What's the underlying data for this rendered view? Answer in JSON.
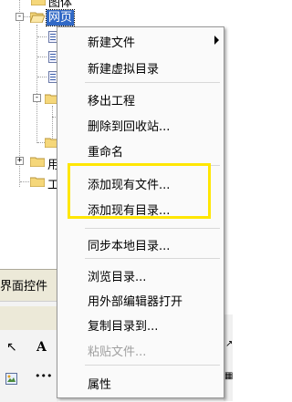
{
  "tree": {
    "nodes": [
      {
        "label": "图体"
      },
      {
        "label": "网页"
      },
      {
        "label": "用"
      },
      {
        "label": "工"
      }
    ]
  },
  "panel": {
    "tab_label": "界面控件",
    "tool_icons": [
      "pointer-icon",
      "text-a-icon",
      "image-icon",
      "dots-icon"
    ]
  },
  "context_menu": {
    "items": [
      {
        "label": "新建文件",
        "submenu": true
      },
      {
        "label": "新建虚拟目录"
      },
      {
        "label": "移出工程"
      },
      {
        "label": "删除到回收站..."
      },
      {
        "label": "重命名"
      },
      {
        "label": "添加现有文件..."
      },
      {
        "label": "添加现有目录..."
      },
      {
        "label": "同步本地目录..."
      },
      {
        "label": "浏览目录..."
      },
      {
        "label": "用外部编辑器打开"
      },
      {
        "label": "复制目录到..."
      },
      {
        "label": "粘贴文件...",
        "disabled": true
      },
      {
        "label": "属性"
      }
    ]
  },
  "colors": {
    "highlight_box": "#ffe600",
    "selection": "#3169c6"
  }
}
